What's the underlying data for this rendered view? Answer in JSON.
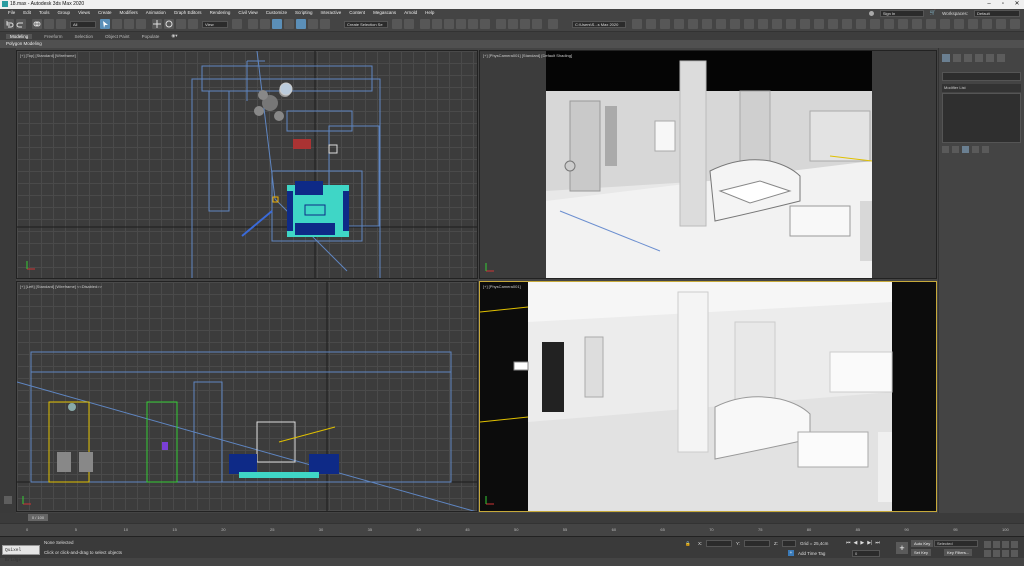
{
  "window": {
    "title": "18.max - Autodesk 3ds Max 2020"
  },
  "menu": [
    "File",
    "Edit",
    "Tools",
    "Group",
    "Views",
    "Create",
    "Modifiers",
    "Animation",
    "Graph Editors",
    "Rendering",
    "Civil View",
    "Customize",
    "Scripting",
    "Interactive",
    "Content",
    "Megascans",
    "Arnold",
    "Help"
  ],
  "account": {
    "sign_in": "Sign In",
    "workspaces_label": "Workspaces:",
    "workspace_value": "Default"
  },
  "toolbar": {
    "filter_value": "All",
    "view_value": "View",
    "selection_set": "Create Selection Se",
    "path": "C:\\Users\\S...s Max 2020"
  },
  "ribbon": {
    "tabs": [
      "Modeling",
      "Freeform",
      "Selection",
      "Object Paint",
      "Populate"
    ],
    "active": "Modeling",
    "sub": "Polygon Modeling"
  },
  "viewports": {
    "top": "[+] [Top] [Standard] [Wireframe]",
    "cam1": "[+] [PhysCamera001] [Standard] [Default Shading]",
    "left": "[+] [Left] [Standard] [Wireframe] <<Disabled>>",
    "cam2": "[+] [PhysCamera001]"
  },
  "command_panel": {
    "modifier_list": "Modifier List"
  },
  "timeline": {
    "slider": "0 / 100",
    "ticks": [
      "0",
      "5",
      "10",
      "15",
      "20",
      "25",
      "30",
      "35",
      "40",
      "45",
      "50",
      "55",
      "60",
      "65",
      "70",
      "75",
      "80",
      "85",
      "90",
      "95",
      "100"
    ]
  },
  "status": {
    "maxscript": "Quixel Bridge",
    "line1": "None Selected",
    "line2": "Click or click-and-drag to select objects",
    "x_label": "X:",
    "y_label": "Y:",
    "z_label": "Z:",
    "grid": "Grid = 25,4cm",
    "add_time_tag": "Add Time Tag",
    "auto_key": "Auto Key",
    "set_key": "Set Key",
    "selected": "Selected",
    "key_filters": "Key Filters...",
    "frame": "0"
  }
}
